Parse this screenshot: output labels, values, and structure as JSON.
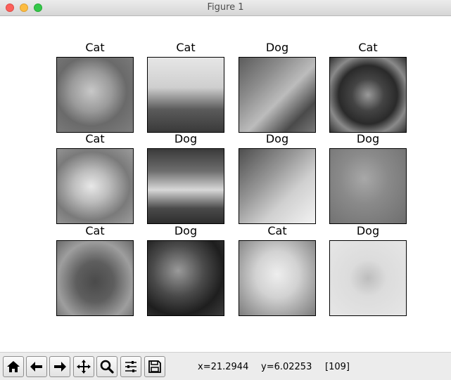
{
  "window": {
    "title": "Figure 1"
  },
  "subplots": [
    {
      "title": "Cat"
    },
    {
      "title": "Cat"
    },
    {
      "title": "Dog"
    },
    {
      "title": "Cat"
    },
    {
      "title": "Cat"
    },
    {
      "title": "Dog"
    },
    {
      "title": "Dog"
    },
    {
      "title": "Dog"
    },
    {
      "title": "Cat"
    },
    {
      "title": "Dog"
    },
    {
      "title": "Cat"
    },
    {
      "title": "Dog"
    }
  ],
  "toolbar": {
    "buttons": [
      {
        "icon": "home-icon"
      },
      {
        "icon": "back-arrow-icon"
      },
      {
        "icon": "forward-arrow-icon"
      },
      {
        "icon": "pan-icon"
      },
      {
        "icon": "zoom-icon"
      },
      {
        "icon": "configure-subplots-icon"
      },
      {
        "icon": "save-icon"
      }
    ],
    "status": {
      "x": "x=21.2944",
      "y": "y=6.02253",
      "value": "[109]"
    }
  },
  "colors": {
    "close": "#fc605b",
    "minimize": "#fdbc40",
    "maximize": "#34c84a"
  }
}
